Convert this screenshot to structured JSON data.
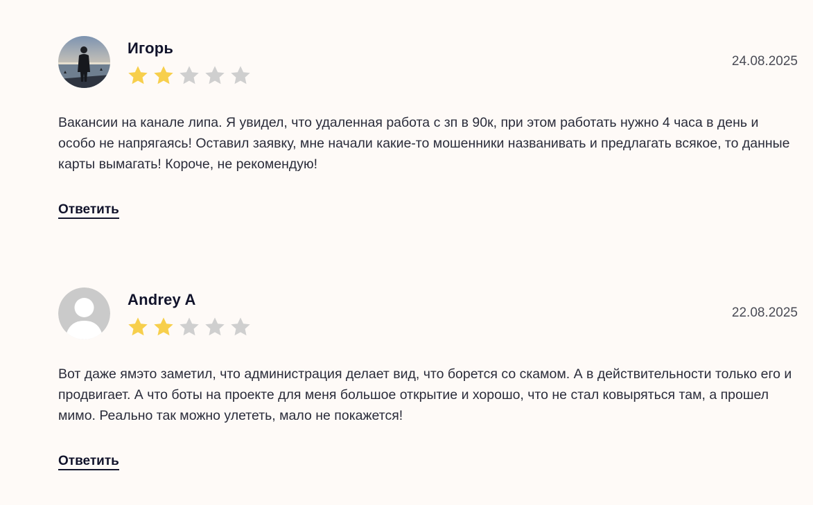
{
  "colors": {
    "background": "#fefaf7",
    "star_filled": "#f7cf4c",
    "star_empty": "#cfcfcf",
    "text": "#2a2c3a",
    "author": "#11132b"
  },
  "reviews": [
    {
      "author": "Игорь",
      "avatar": "photo-avatar",
      "rating": 2,
      "max_rating": 5,
      "date": "24.08.2025",
      "text": "Вакансии на канале липа. Я увидел, что удаленная работа с зп в 90к, при этом работать нужно 4 часа в день и особо не напрягаясь! Оставил заявку, мне начали какие-то мошенники названивать и предлагать всякое, то данные карты вымагать! Короче, не рекомендую!",
      "reply_label": "Ответить"
    },
    {
      "author": "Andrey A",
      "avatar": "default-user-avatar",
      "rating": 2,
      "max_rating": 5,
      "date": "22.08.2025",
      "text": "Вот даже ямэто заметил, что администрация делает вид, что борется со скамом. А в действительности только его и продвигает. А что боты на проекте для меня большое открытие и хорошо, что не стал ковыряться там, а прошел мимо. Реально так можно улететь, мало не покажется!",
      "reply_label": "Ответить"
    }
  ]
}
